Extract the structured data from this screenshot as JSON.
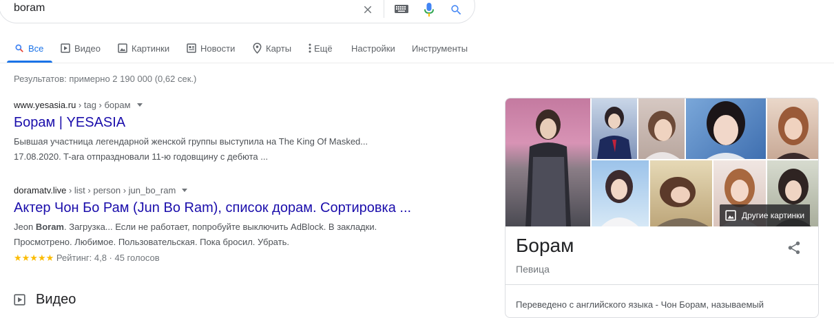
{
  "search": {
    "query": "boram",
    "clear_icon": "close-icon",
    "keyboard_icon": "keyboard-icon",
    "mic_icon": "mic-icon",
    "search_icon": "search-icon"
  },
  "tabs": [
    {
      "label": "Все",
      "icon": "search-icon",
      "active": true
    },
    {
      "label": "Видео",
      "icon": "play-icon"
    },
    {
      "label": "Картинки",
      "icon": "image-icon"
    },
    {
      "label": "Новости",
      "icon": "news-icon"
    },
    {
      "label": "Карты",
      "icon": "map-pin-icon"
    },
    {
      "label": "Ещё",
      "icon": "more-vert-icon"
    },
    {
      "label": "Настройки"
    },
    {
      "label": "Инструменты"
    }
  ],
  "result_stats": "Результатов: примерно 2 190 000 (0,62 сек.)",
  "results": [
    {
      "domain": "www.yesasia.ru",
      "path": " › tag › борам",
      "title": "Борам | YESASIA",
      "snippet_line1": "Бывшая участница легендарной женской группы выступила на The King Of Masked...",
      "snippet_line2": "17.08.2020. T-ara отпраздновали 11-ю годовщину с дебюта ..."
    },
    {
      "domain": "doramatv.live",
      "path": " › list › person › jun_bo_ram",
      "title": "Актер Чон Бо Рам (Jun Bo Ram), список дорам. Сортировка ...",
      "snippet_pre": "Jeon ",
      "snippet_bold": "Boram",
      "snippet_post": ". Загрузка... Если не работает, попробуйте выключить AdBlock. В закладки.",
      "snippet_line2": "Просмотрено. Любимое. Пользовательская. Пока бросил. Убрать.",
      "stars": "★★★★★",
      "rating": "Рейтинг: 4,8 · 45 голосов"
    }
  ],
  "video_section": {
    "title": "Видео",
    "icon": "play-icon"
  },
  "knowledge_panel": {
    "more_images_label": "Другие картинки",
    "title": "Борам",
    "subtitle": "Певица",
    "description": "Переведено с английского языка - Чон Борам, называемый",
    "share_icon": "share-icon"
  }
}
